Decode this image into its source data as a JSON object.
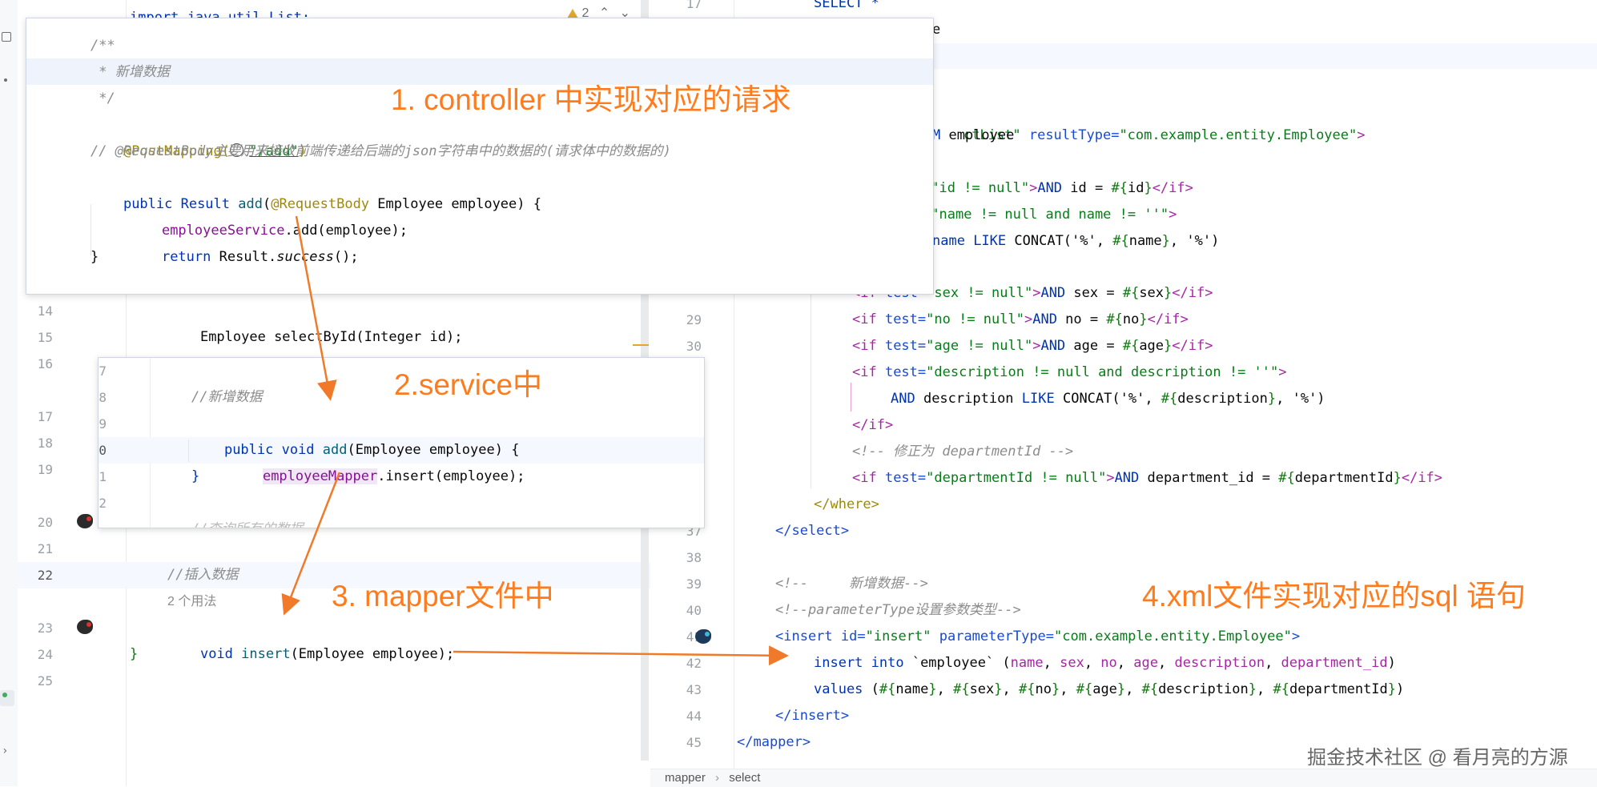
{
  "left_editor": {
    "top_line": "import java.util.List;",
    "inspection_count": "2",
    "line_numbers": [
      "14",
      "15",
      "16",
      "17",
      "18",
      "19",
      "20",
      "21",
      "22",
      "",
      "23",
      "24",
      "25"
    ],
    "lines": {
      "select_by_id": "Employee selectById(Integer id);",
      "insert_comment": "//插入数据",
      "usages_hint": "2 个用法",
      "insert_decl_type": "void ",
      "insert_decl_name": "insert",
      "insert_decl_args": "(Employee employee);",
      "closing_brace": "}"
    }
  },
  "controller_popup": {
    "doc_open": "/**",
    "doc_text": " * 新增数据",
    "doc_close": " */",
    "annotation": "@PostMapping(",
    "path": "\"/add\"",
    "annotation_close": ")",
    "comment": "// @RequestBody主要用来接收前端传递给后端的json字符串中的数据的(请求体中的数据的)",
    "method_sig_1": "public Result ",
    "method_name": "add",
    "method_sig_2": "(",
    "request_body": "@RequestBody",
    "method_sig_3": " Employee employee) {",
    "call_field": "employeeService",
    "call_rest": ".add(employee);",
    "return_kw": "return ",
    "return_rest_1": "Result.",
    "return_success": "success",
    "return_rest_2": "();",
    "closing": "}"
  },
  "service_popup": {
    "line_numbers": [
      "7",
      "8",
      "9",
      "0",
      "1",
      "2",
      "7"
    ],
    "comment": "//新增数据",
    "sig_kw": "public void ",
    "sig_name": "add",
    "sig_rest": "(Employee employee) {",
    "call_field": "employeeMapper",
    "call_rest": ".insert(employee);",
    "closing": "}",
    "cut_line": "//查询所有的数据"
  },
  "right_editor": {
    "line_numbers_top": [
      "17"
    ],
    "line_numbers": [
      "29",
      "30",
      "37",
      "38",
      "39",
      "40",
      "41",
      "42",
      "43",
      "44",
      "45"
    ],
    "select_star": "SELECT *",
    "e_frag": "e",
    "select_tag_tail": "ctList\" resultType=\"com.example.entity.Employee\">",
    "from_tail": "M employee",
    "if_id": "=\"id != null\">AND id = #{id}</if>",
    "if_name": "=\"name != null and name != ''\">",
    "name_like": "name LIKE CONCAT('%', #{name}, '%')",
    "if_sex": "<if test=\"sex != null\">AND sex = #{sex}</if>",
    "if_no": "<if test=\"no != null\">AND no = #{no}</if>",
    "if_age": "<if test=\"age != null\">AND age = #{age}</if>",
    "if_desc": "<if test=\"description != null and description != ''\">",
    "desc_like": "AND description LIKE CONCAT('%', #{description}, '%')",
    "if_close": "</if>",
    "dept_comment": "<!-- 修正为 departmentId -->",
    "if_dept": "<if test=\"departmentId != null\">AND department_id = #{departmentId}</if>",
    "where_close": "</where>",
    "select_close": "</select>",
    "insert_comment": "<!--     新增数据-->",
    "param_comment": "<!--parameterType设置参数类型-->",
    "insert_open": "<insert id=\"insert\" parameterType=\"com.example.entity.Employee\">",
    "insert_into": "insert into `employee` (name, sex, no, age, description, department_id)",
    "values": "values (#{name}, #{sex}, #{no}, #{age}, #{description}, #{departmentId})",
    "insert_close": "</insert>",
    "mapper_close": "</mapper>",
    "breadcrumb": [
      "mapper",
      "select"
    ]
  },
  "annotations": {
    "step1": "1. controller 中实现对应的请求",
    "step2": "2.service中",
    "step3": "3. mapper文件中",
    "step4": "4.xml文件实现对应的sql 语句",
    "arrow_color": "#f07a2a"
  },
  "watermark": "掘金技术社区 @ 看月亮的方源"
}
